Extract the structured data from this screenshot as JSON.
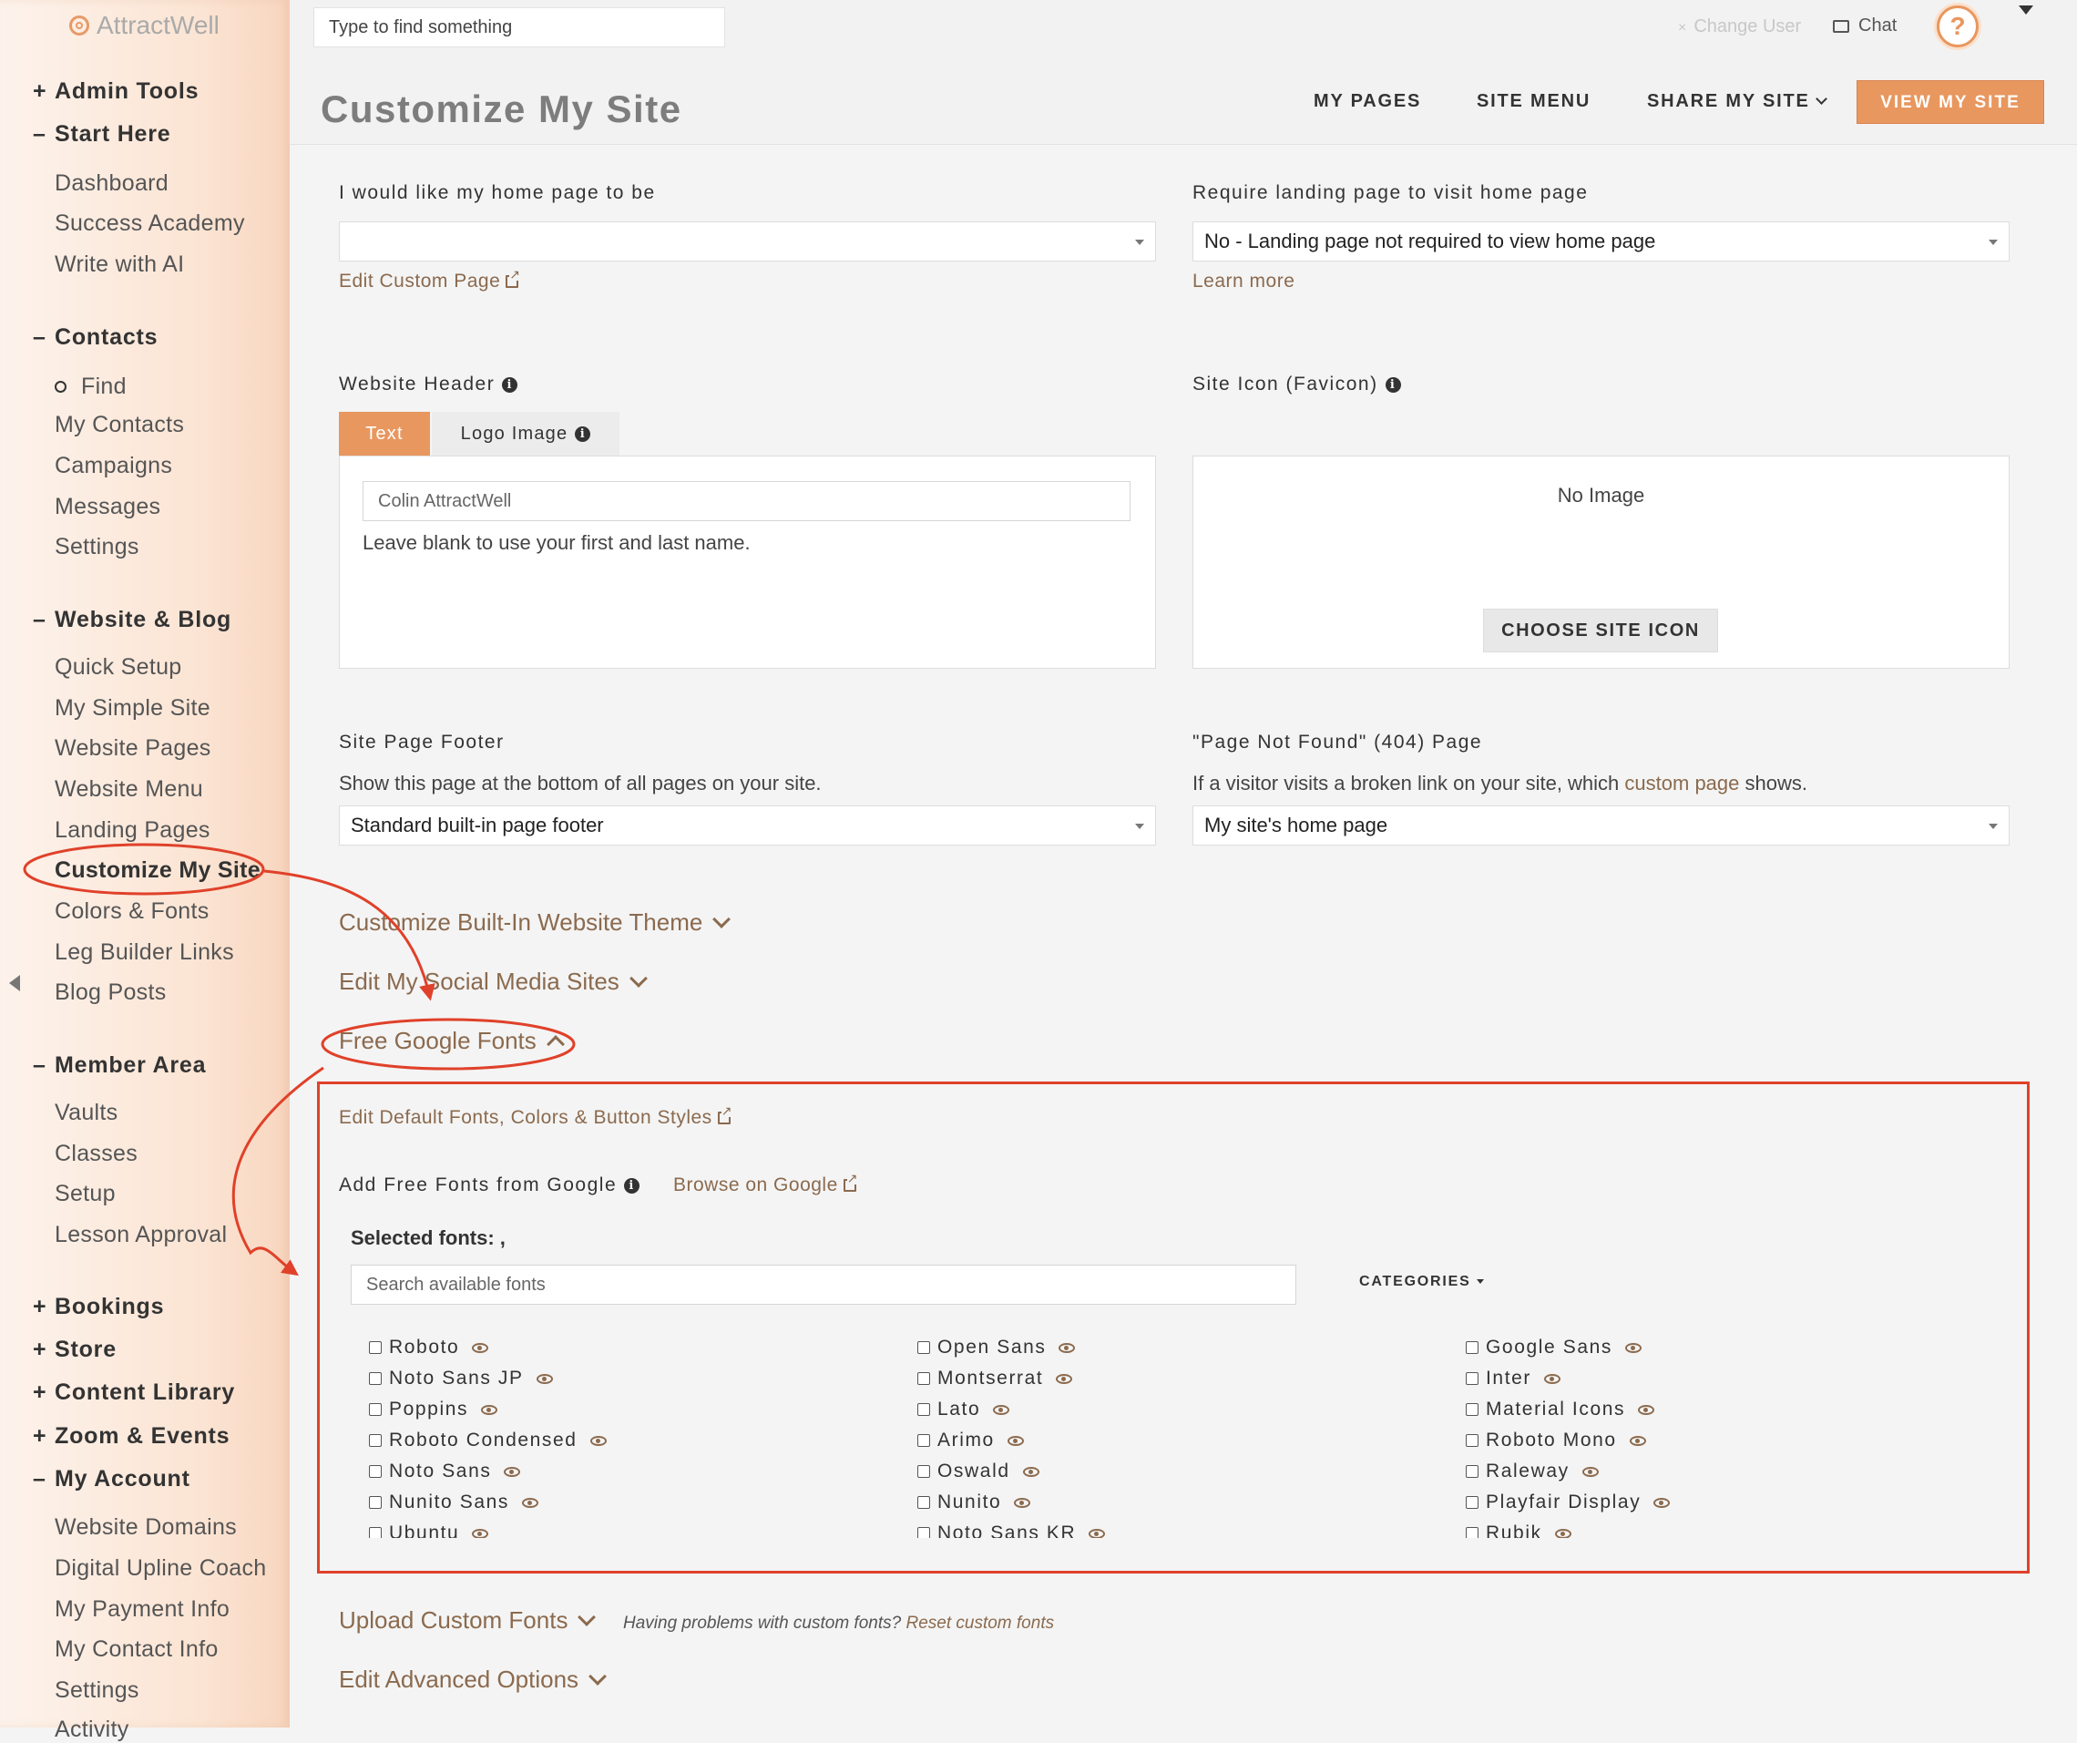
{
  "app": {
    "name": "AttractWell"
  },
  "sidebar": {
    "sections": [
      {
        "sign": "+",
        "label": "Admin Tools"
      },
      {
        "sign": "–",
        "label": "Start Here"
      },
      {
        "sign": "–",
        "label": "Contacts"
      },
      {
        "sign": "–",
        "label": "Website & Blog"
      },
      {
        "sign": "–",
        "label": "Member Area"
      },
      {
        "sign": "+",
        "label": "Bookings"
      },
      {
        "sign": "+",
        "label": "Store"
      },
      {
        "sign": "+",
        "label": "Content Library"
      },
      {
        "sign": "+",
        "label": "Zoom & Events"
      },
      {
        "sign": "–",
        "label": "My Account"
      }
    ],
    "start_here": [
      "Dashboard",
      "Success Academy",
      "Write with AI"
    ],
    "contacts": [
      "Find",
      "My Contacts",
      "Campaigns",
      "Messages",
      "Settings"
    ],
    "website_blog": [
      "Quick Setup",
      "My Simple Site",
      "Website Pages",
      "Website Menu",
      "Landing Pages",
      "Customize My Site",
      "Colors & Fonts",
      "Leg Builder Links",
      "Blog Posts"
    ],
    "member_area": [
      "Vaults",
      "Classes",
      "Setup",
      "Lesson Approval"
    ],
    "my_account": [
      "Website Domains",
      "Digital Upline Coach",
      "My Payment Info",
      "My Contact Info",
      "Settings",
      "Activity"
    ]
  },
  "header": {
    "search_placeholder": "Type to find something",
    "change_user": "Change User",
    "chat": "Chat",
    "help": "?",
    "page_title": "Customize My Site",
    "nav": {
      "my_pages": "MY PAGES",
      "site_menu": "SITE MENU",
      "share": "SHARE MY SITE",
      "view": "VIEW MY SITE"
    }
  },
  "home_page": {
    "label": "I would like my home page to be",
    "value": "",
    "edit_link": "Edit Custom Page"
  },
  "landing_req": {
    "label": "Require landing page to visit home page",
    "value": "No - Landing page not required to view home page",
    "learn_more": "Learn more"
  },
  "website_header": {
    "label": "Website Header",
    "tab_text": "Text",
    "tab_logo": "Logo Image",
    "input_placeholder": "Colin AttractWell",
    "hint": "Leave blank to use your first and last name."
  },
  "site_icon": {
    "label": "Site Icon (Favicon)",
    "no_image": "No Image",
    "button": "CHOOSE SITE ICON"
  },
  "footer": {
    "label": "Site Page Footer",
    "desc": "Show this page at the bottom of all pages on your site.",
    "value": "Standard built-in page footer"
  },
  "not_found": {
    "label": "\"Page Not Found\" (404) Page",
    "desc_pre": "If a visitor visits a broken link on your site, which ",
    "desc_link": "custom page",
    "desc_post": " shows.",
    "value": "My site's home page"
  },
  "accordions": {
    "theme": "Customize Built-In Website Theme",
    "social": "Edit My Social Media Sites",
    "google_fonts": "Free Google Fonts",
    "upload": "Upload Custom Fonts",
    "advanced": "Edit Advanced Options"
  },
  "google_fonts": {
    "edit_defaults": "Edit Default Fonts, Colors & Button Styles",
    "add_label": "Add Free Fonts from Google",
    "browse": "Browse on Google",
    "selected": "Selected fonts: ,",
    "search_placeholder": "Search available fonts",
    "categories": "CATEGORIES",
    "col1": [
      "Roboto",
      "Noto Sans JP",
      "Poppins",
      "Roboto Condensed",
      "Noto Sans",
      "Nunito Sans",
      "Ubuntu"
    ],
    "col2": [
      "Open Sans",
      "Montserrat",
      "Lato",
      "Arimo",
      "Oswald",
      "Nunito",
      "Noto Sans KR"
    ],
    "col3": [
      "Google Sans",
      "Inter",
      "Material Icons",
      "Roboto Mono",
      "Raleway",
      "Playfair Display",
      "Rubik"
    ]
  },
  "upload_help": {
    "text": "Having problems with custom fonts?",
    "link": "Reset custom fonts"
  },
  "colors": {
    "accent": "#e8975f",
    "link": "#8b6a4e",
    "annotation": "#e0412a"
  }
}
